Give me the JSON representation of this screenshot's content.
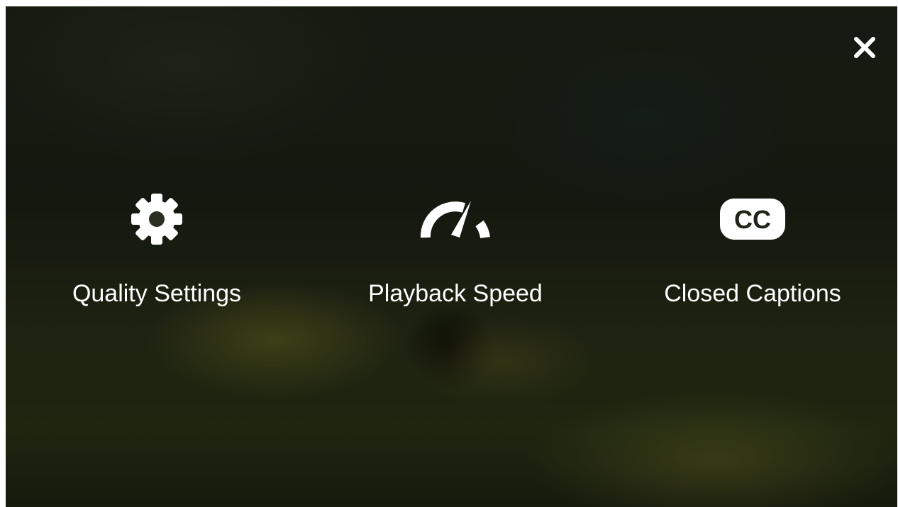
{
  "overlay": {
    "close_icon": "close-icon",
    "text_color": "#ffffff"
  },
  "options": [
    {
      "label": "Quality Settings",
      "icon": "gear-icon"
    },
    {
      "label": "Playback Speed",
      "icon": "speedometer-icon"
    },
    {
      "label": "Closed Captions",
      "icon": "closed-captions-icon",
      "icon_text": "CC"
    }
  ]
}
